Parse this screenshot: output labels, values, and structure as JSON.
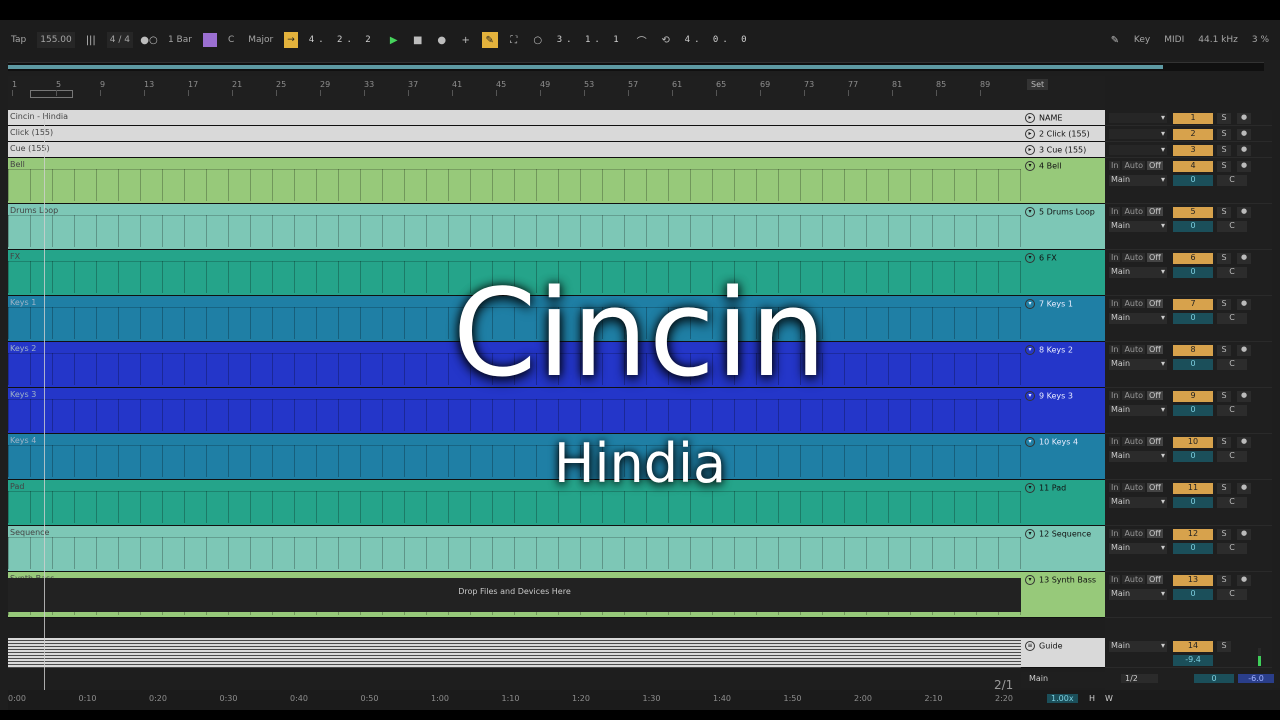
{
  "toolbar": {
    "tap": "Tap",
    "tempo": "155.00",
    "signature": "4 / 4",
    "quantize": "1 Bar",
    "key": "C",
    "scale": "Major",
    "arr_position": "4.  2.  2",
    "loop_start": "3.  1.  1",
    "loop_length": "4.  0.  0",
    "key_label": "Key",
    "midi_label": "MIDI",
    "sample_rate": "44.1 kHz",
    "cpu": "3 %"
  },
  "ruler": {
    "bars": [
      "1",
      "5",
      "9",
      "13",
      "17",
      "21",
      "25",
      "29",
      "33",
      "37",
      "41",
      "45",
      "49",
      "53",
      "57",
      "61",
      "65",
      "69",
      "73",
      "77",
      "81",
      "85",
      "89"
    ],
    "set_label": "Set"
  },
  "tracks": [
    {
      "lane_name": "Cincin - Hindia",
      "head": "NAME",
      "num": "1",
      "color": "#d9d9d9",
      "style": "light",
      "h": 16,
      "mixer": false
    },
    {
      "lane_name": "Click (155)",
      "head": "2 Click (155)",
      "num": "2",
      "color": "#d9d9d9",
      "style": "light",
      "h": 16,
      "mixer": false
    },
    {
      "lane_name": "Cue (155)",
      "head": "3 Cue (155)",
      "num": "3",
      "color": "#d9d9d9",
      "style": "light",
      "h": 16,
      "mixer": false
    },
    {
      "lane_name": "Bell",
      "head": "4 Bell",
      "num": "4",
      "color": "#97c97a",
      "style": "light",
      "h": 46,
      "mixer": true
    },
    {
      "lane_name": "Drums Loop",
      "head": "5 Drums Loop",
      "num": "5",
      "color": "#7dc7b6",
      "style": "light",
      "h": 46,
      "mixer": true
    },
    {
      "lane_name": "FX",
      "head": "6 FX",
      "num": "6",
      "color": "#25a48a",
      "style": "light",
      "h": 46,
      "mixer": true
    },
    {
      "lane_name": "Keys 1",
      "head": "7 Keys 1",
      "num": "7",
      "color": "#1f7fa5",
      "style": "dark",
      "h": 46,
      "mixer": true
    },
    {
      "lane_name": "Keys 2",
      "head": "8 Keys 2",
      "num": "8",
      "color": "#2436c9",
      "style": "dark",
      "h": 46,
      "mixer": true
    },
    {
      "lane_name": "Keys 3",
      "head": "9 Keys 3",
      "num": "9",
      "color": "#2436c9",
      "style": "dark",
      "h": 46,
      "mixer": true
    },
    {
      "lane_name": "Keys 4",
      "head": "10 Keys 4",
      "num": "10",
      "color": "#1f7fa5",
      "style": "dark",
      "h": 46,
      "mixer": true
    },
    {
      "lane_name": "Pad",
      "head": "11 Pad",
      "num": "11",
      "color": "#25a48a",
      "style": "light",
      "h": 46,
      "mixer": true
    },
    {
      "lane_name": "Sequence",
      "head": "12 Sequence",
      "num": "12",
      "color": "#7dc7b6",
      "style": "light",
      "h": 46,
      "mixer": true
    },
    {
      "lane_name": "Synth Bass",
      "head": "13 Synth Bass",
      "num": "13",
      "color": "#97c97a",
      "style": "light",
      "h": 46,
      "mixer": true
    }
  ],
  "guide": {
    "head": "Guide",
    "num": "14",
    "route": "Main",
    "vol": "-9.4"
  },
  "mixer": {
    "in": "In",
    "auto": "Auto",
    "off": "Off",
    "route": "Main",
    "vol": "0",
    "solo": "S",
    "pan": "C"
  },
  "drop_text": "Drop Files and Devices Here",
  "bottom": {
    "page": "2/1",
    "main_label": "Main",
    "main_route": "1/2",
    "main_vol": "0",
    "main_db": "-6.0",
    "zoom": "1.00x",
    "h": "H",
    "w": "W",
    "times": [
      "0:00",
      "0:10",
      "0:20",
      "0:30",
      "0:40",
      "0:50",
      "1:00",
      "1:10",
      "1:20",
      "1:30",
      "1:40",
      "1:50",
      "2:00",
      "2:10",
      "2:20"
    ]
  },
  "overlay": {
    "title": "Cincin",
    "subtitle": "Hindia"
  }
}
